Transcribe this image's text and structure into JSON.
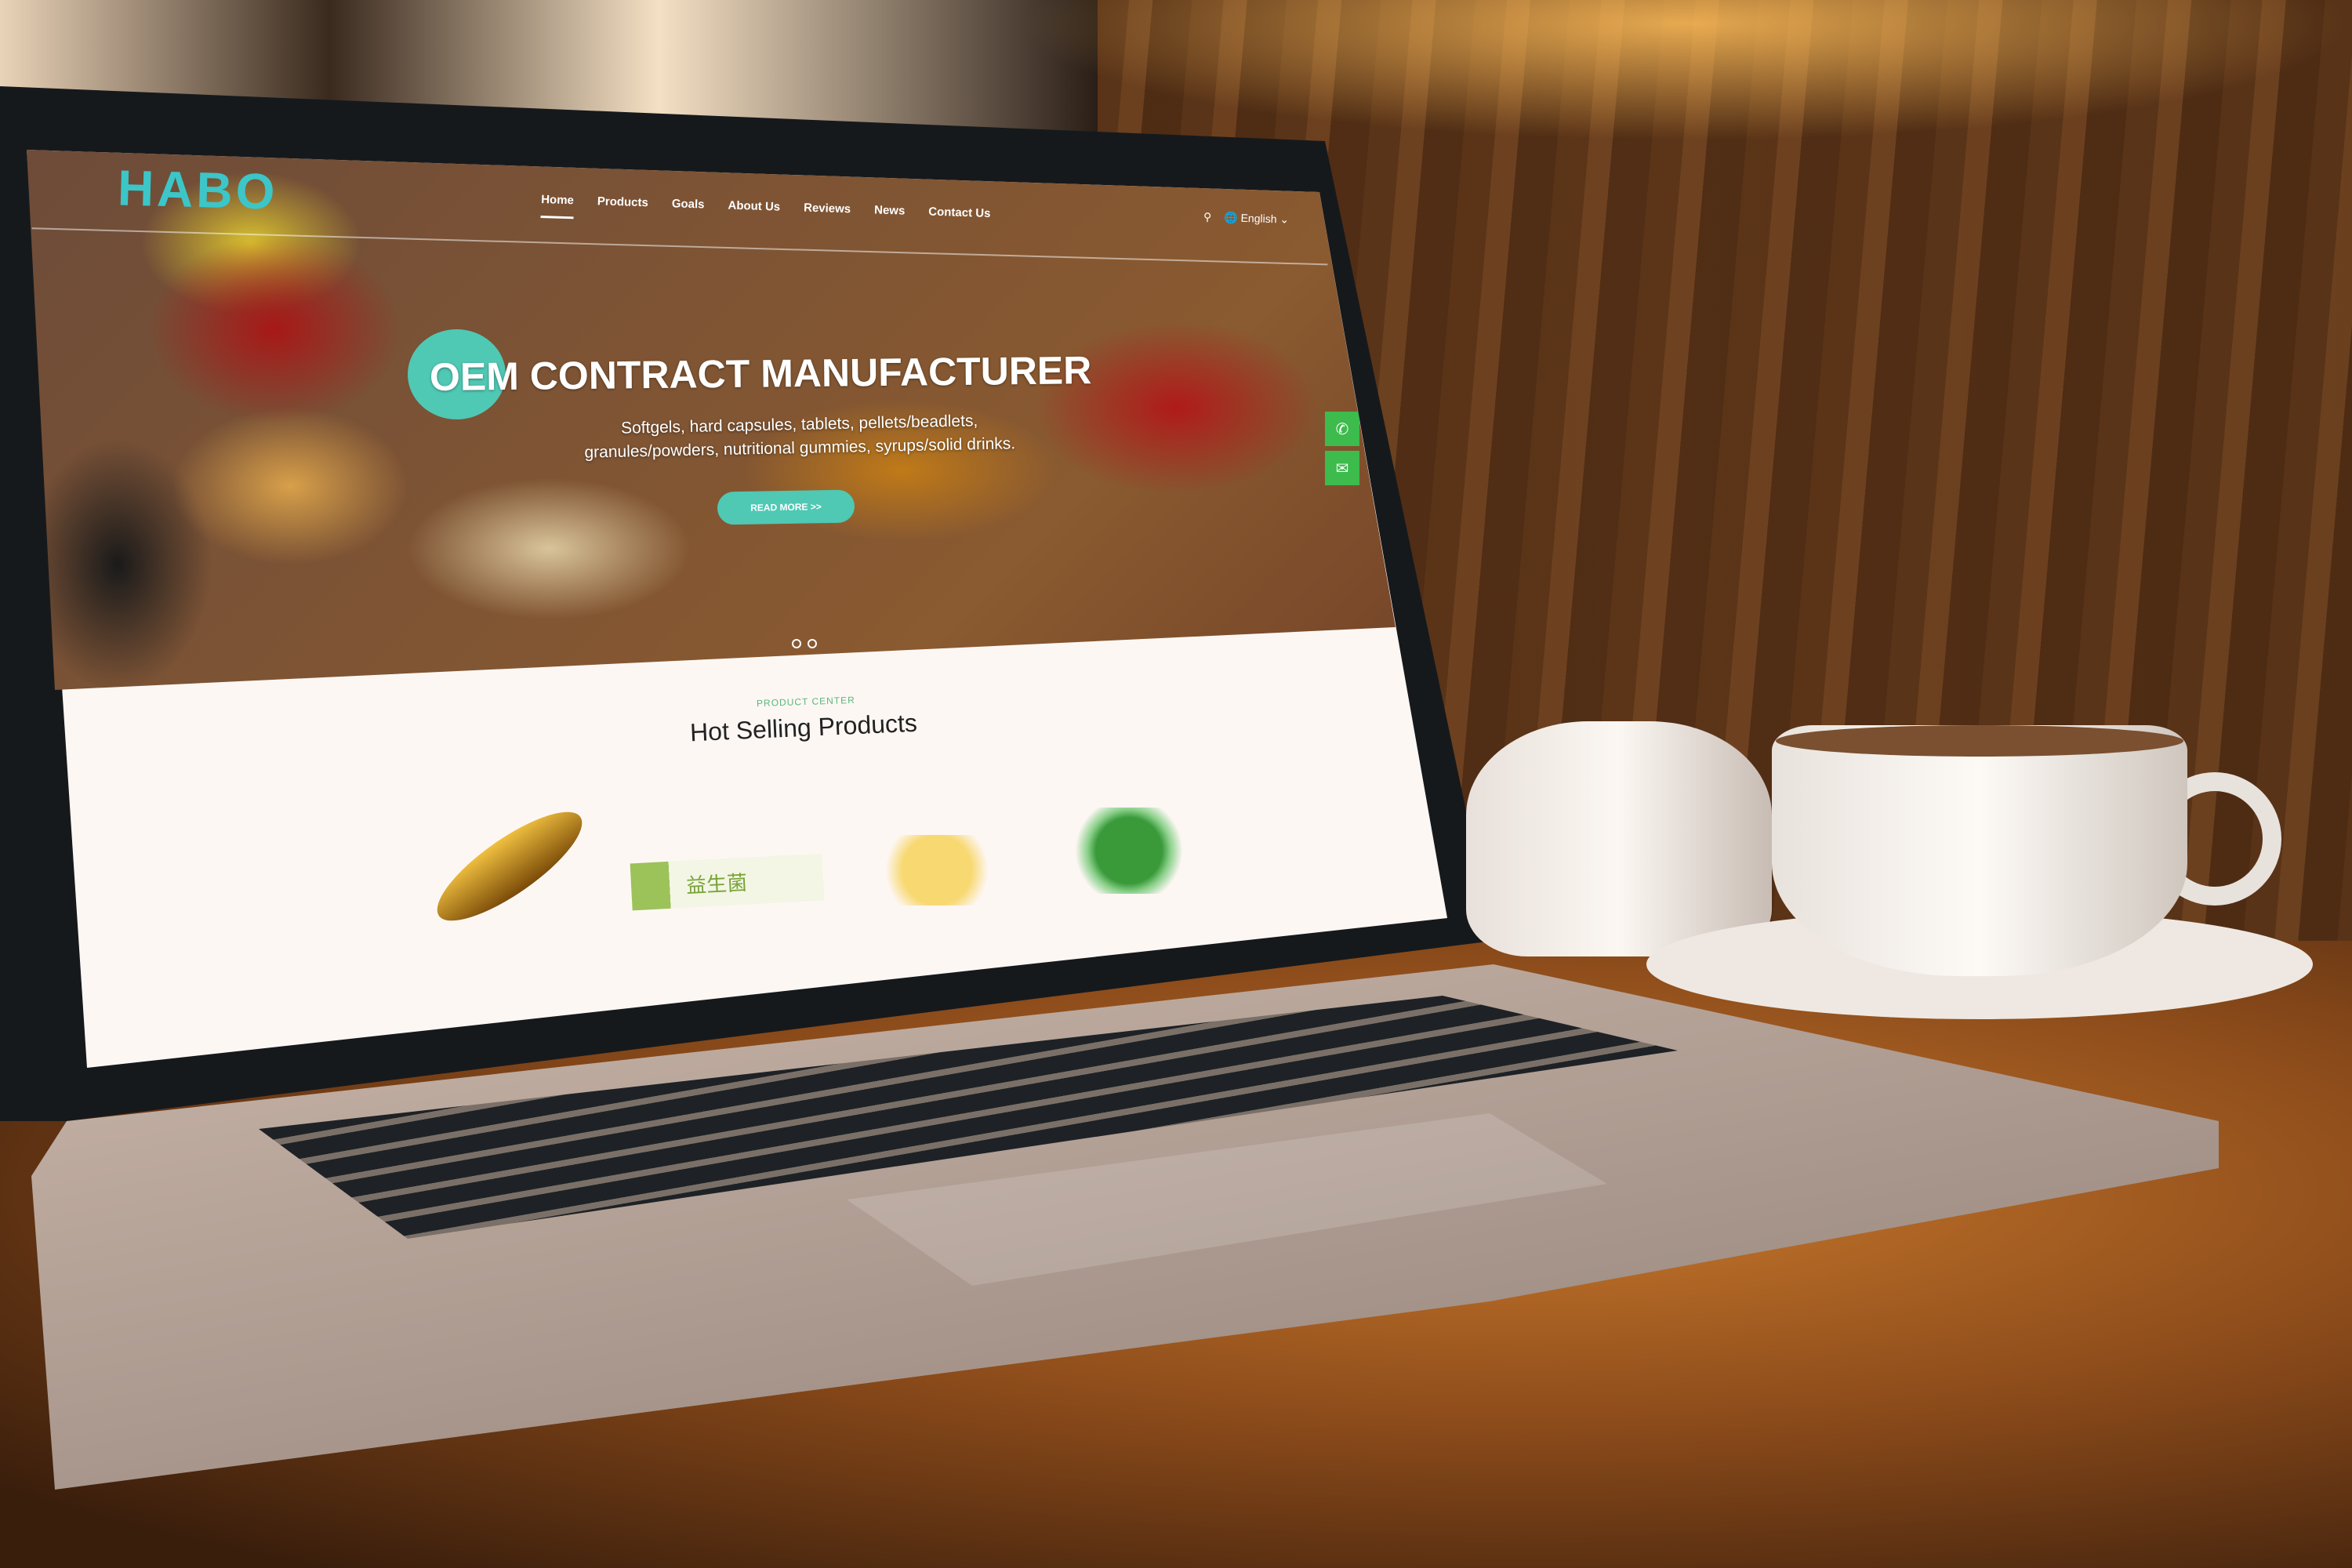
{
  "site": {
    "logo": "HABO",
    "nav": [
      "Home",
      "Products",
      "Goals",
      "About Us",
      "Reviews",
      "News",
      "Contact Us"
    ],
    "active_nav": "Home",
    "language": "English",
    "icons": {
      "search": "search-icon",
      "language": "globe-icon",
      "phone": "phone-icon",
      "email": "mail-icon"
    }
  },
  "hero": {
    "title": "OEM CONTRACT MANUFACTURER",
    "subtitle_line1": "Softgels, hard capsules, tablets, pellets/beadlets,",
    "subtitle_line2": "granules/powders, nutritional gummies, syrups/solid drinks.",
    "button": "READ MORE >>",
    "slides": 2,
    "accent": "#4fc8b4"
  },
  "products": {
    "eyebrow": "PRODUCT CENTER",
    "heading": "Hot Selling Products",
    "items": [
      {
        "name": "softgel"
      },
      {
        "name": "probiotic stick pack",
        "label": "益生菌"
      },
      {
        "name": "yellow capsules"
      },
      {
        "name": "green capsules"
      }
    ]
  }
}
